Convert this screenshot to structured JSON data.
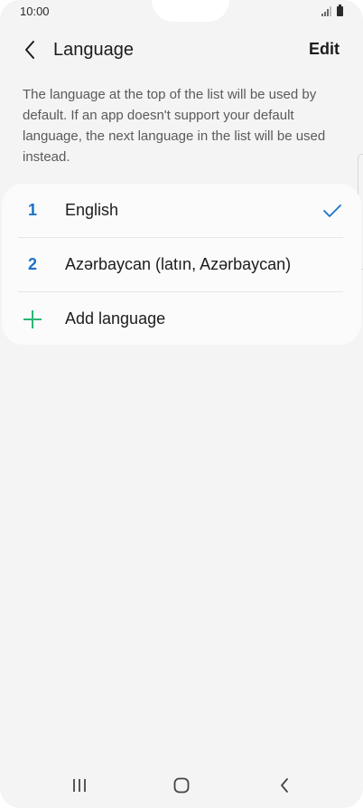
{
  "status_bar": {
    "time": "10:00"
  },
  "header": {
    "title": "Language",
    "edit_label": "Edit"
  },
  "description": "The language at the top of the list will be used by default. If an app doesn't support your default language, the next language in the list will be used instead.",
  "languages": [
    {
      "number": "1",
      "label": "English",
      "selected": true
    },
    {
      "number": "2",
      "label": "Azərbaycan (latın, Azərbaycan)",
      "selected": false
    }
  ],
  "add_language": {
    "label": "Add language"
  },
  "icons": {
    "back": "chevron-left-icon",
    "check": "check-icon",
    "add": "plus-icon",
    "recents": "recents-icon",
    "home": "home-icon",
    "nav_back": "nav-back-icon"
  },
  "colors": {
    "accent_blue": "#1a73c9",
    "add_green": "#2bb673",
    "background": "#f4f4f4",
    "card": "#fbfbfb"
  }
}
